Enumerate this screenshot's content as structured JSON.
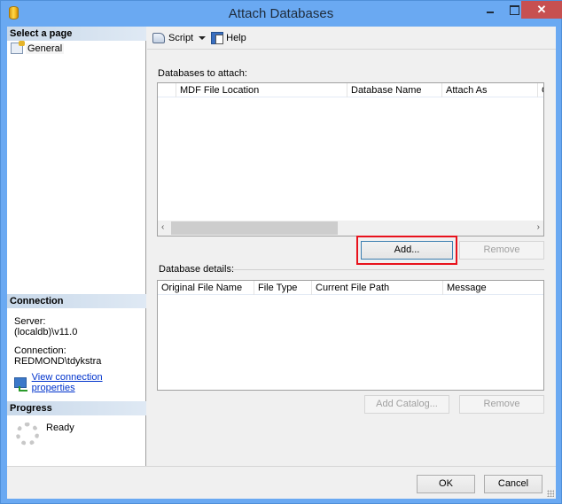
{
  "window": {
    "title": "Attach Databases",
    "icon": "database-icon",
    "controls": {
      "minimize": "minimize",
      "maximize": "maximize",
      "close": "✕"
    }
  },
  "left_pane": {
    "select_page": {
      "header": "Select a page",
      "items": [
        {
          "label": "General",
          "icon": "page-general-icon"
        }
      ]
    },
    "connection": {
      "header": "Connection",
      "server_label": "Server:",
      "server_value": "(localdb)\\v11.0",
      "connection_label": "Connection:",
      "connection_value": "REDMOND\\tdykstra",
      "view_properties_link": "View connection properties"
    },
    "progress": {
      "header": "Progress",
      "status": "Ready"
    }
  },
  "toolbar": {
    "script_label": "Script",
    "help_label": "Help"
  },
  "databases_to_attach": {
    "label": "Databases to attach:",
    "columns": [
      "",
      "MDF File Location",
      "Database Name",
      "Attach As",
      "O"
    ],
    "rows": [],
    "add_button": "Add...",
    "remove_button": "Remove"
  },
  "database_details": {
    "label": "Database details:",
    "columns": [
      "Original File Name",
      "File Type",
      "Current File Path",
      "Message"
    ],
    "rows": [],
    "add_catalog_button": "Add Catalog...",
    "remove_button": "Remove"
  },
  "footer": {
    "ok_button": "OK",
    "cancel_button": "Cancel"
  },
  "colors": {
    "title_bar": "#6aa9f2",
    "close_button": "#c75050",
    "highlight_box": "#e8121c",
    "link": "#0033cc"
  }
}
